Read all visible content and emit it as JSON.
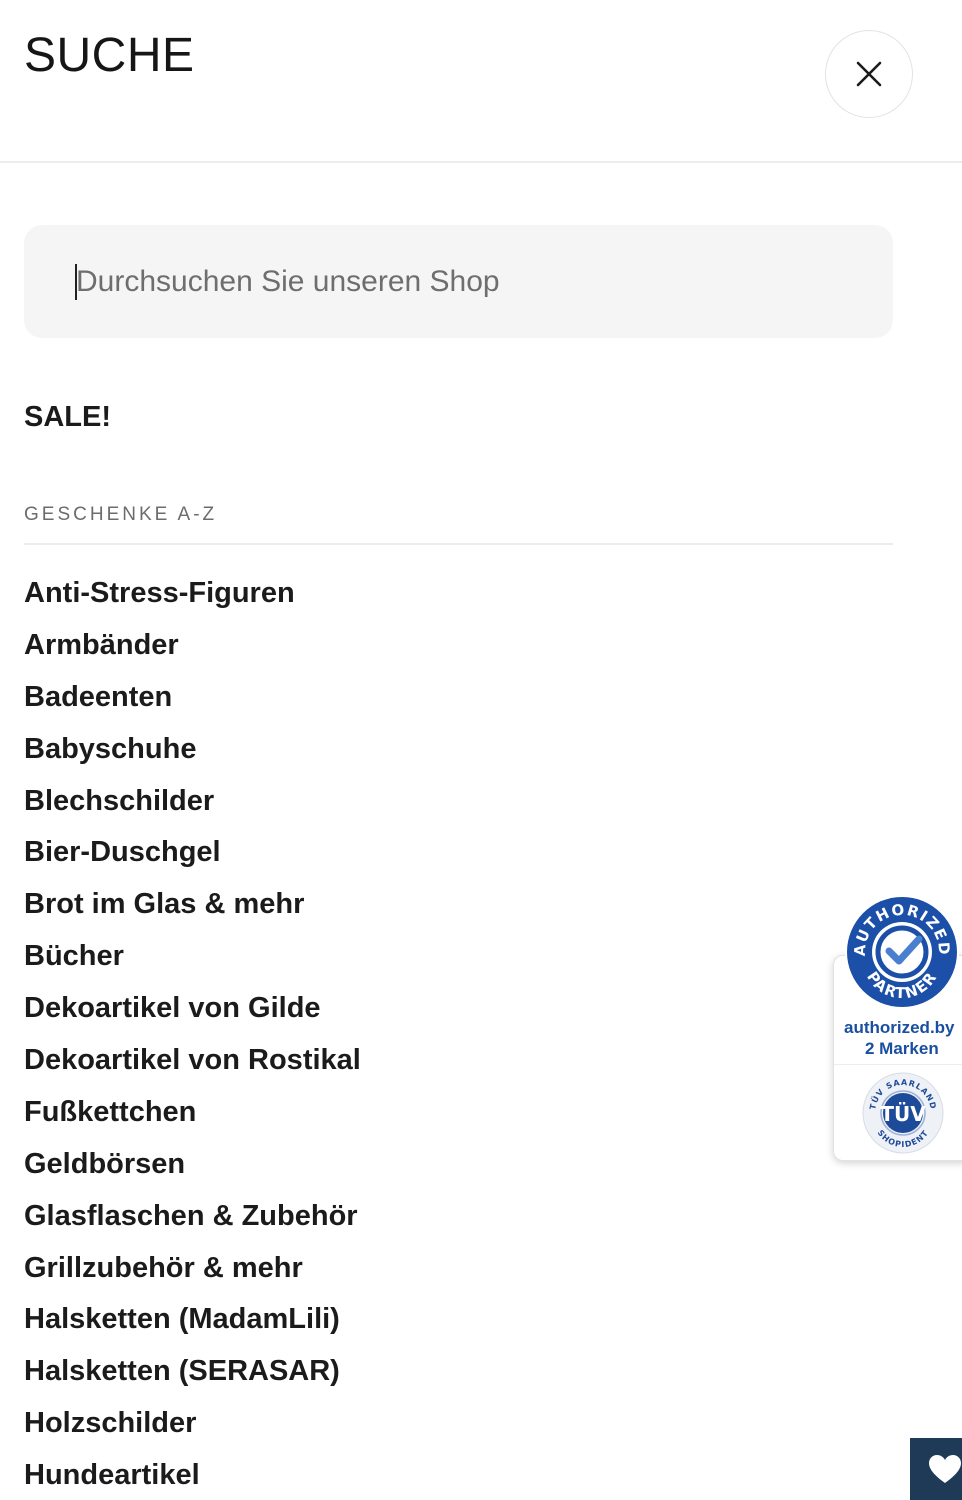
{
  "header": {
    "title": "SUCHE",
    "close_icon": "close-icon"
  },
  "search": {
    "placeholder": "Durchsuchen Sie unseren Shop",
    "value": ""
  },
  "sale": {
    "label": "SALE!"
  },
  "gifts_section": {
    "heading": "GESCHENKE A-Z",
    "items": [
      "Anti-Stress-Figuren",
      "Armbänder",
      "Badeenten",
      "Babyschuhe",
      "Blechschilder",
      "Bier-Duschgel",
      "Brot im Glas & mehr",
      "Bücher",
      "Dekoartikel von Gilde",
      "Dekoartikel von Rostikal",
      "Fußkettchen",
      "Geldbörsen",
      "Glasflaschen & Zubehör",
      "Grillzubehör & mehr",
      "Halsketten (MadamLili)",
      "Halsketten (SERASAR)",
      "Holzschilder",
      "Hundeartikel"
    ]
  },
  "trust_badge": {
    "seal_text": "AUTHORIZED PARTNER",
    "line1": "authorized.by",
    "line2": "2 Marken",
    "tuv_text": "TÜV SAARLAND SHOPIDENT",
    "tuv_logo": "TÜV",
    "seal_icon": "authorized-partner-seal-icon",
    "tuv_icon": "tuv-saarland-seal-icon",
    "accent_color": "#1a4fa0"
  },
  "wishlist": {
    "icon": "heart-icon",
    "color": "#1e3a57"
  }
}
